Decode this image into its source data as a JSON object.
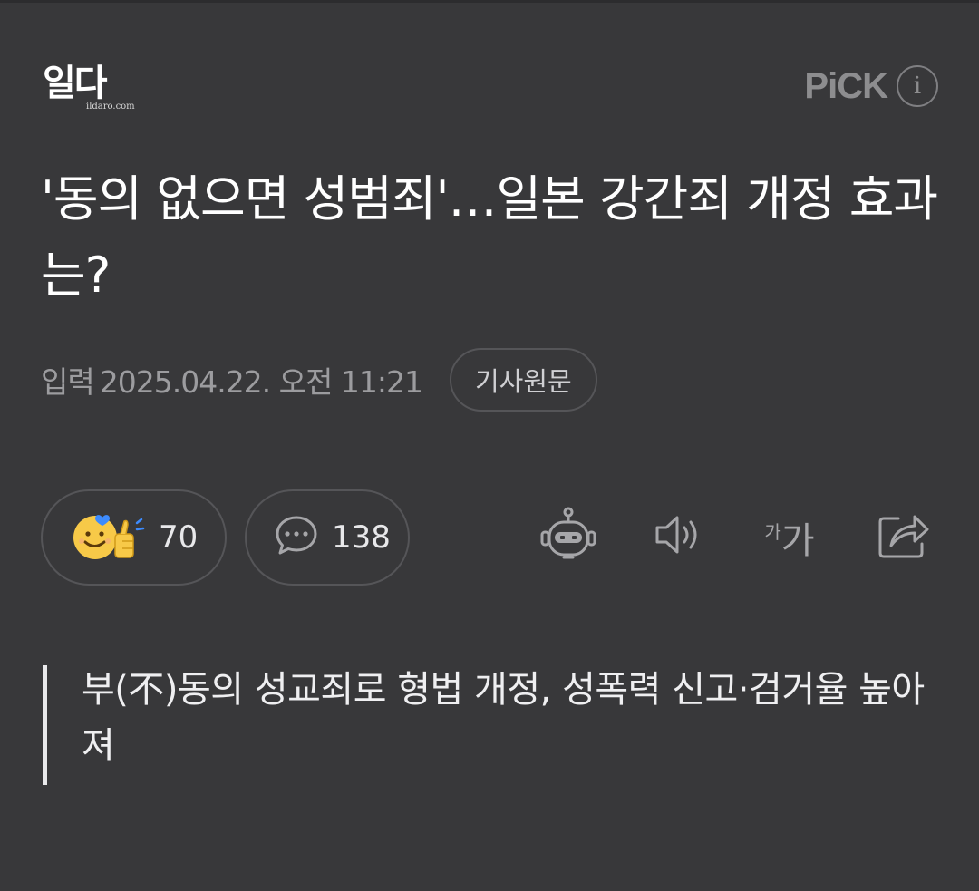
{
  "press": {
    "logo_text": "일다",
    "logo_domain": "ildaro.com"
  },
  "header": {
    "pick_label": "PiCK",
    "info_label": "i"
  },
  "article": {
    "title": "'동의 없으면 성범죄'…일본 강간죄 개정 효과는?",
    "date_label": "입력",
    "date_value": "2025.04.22. 오전 11:21",
    "original_button": "기사원문",
    "summary": "부(不)동의 성교죄로 형법 개정, 성폭력 신고·검거율 높아져"
  },
  "actions": {
    "reaction_count": "70",
    "comment_count": "138"
  },
  "tools": {
    "font_small": "가",
    "font_big": "가"
  },
  "icons": [
    "smile-icon",
    "thumbs-up-icon",
    "comment-bubble-icon",
    "ai-bot-icon",
    "speaker-icon",
    "font-size-icon",
    "share-icon"
  ],
  "colors": {
    "background": "#38383a",
    "text": "#ffffff",
    "muted": "#9c9c9f",
    "accent_smile": "#f7c948",
    "heart": "#3d8bfd"
  }
}
